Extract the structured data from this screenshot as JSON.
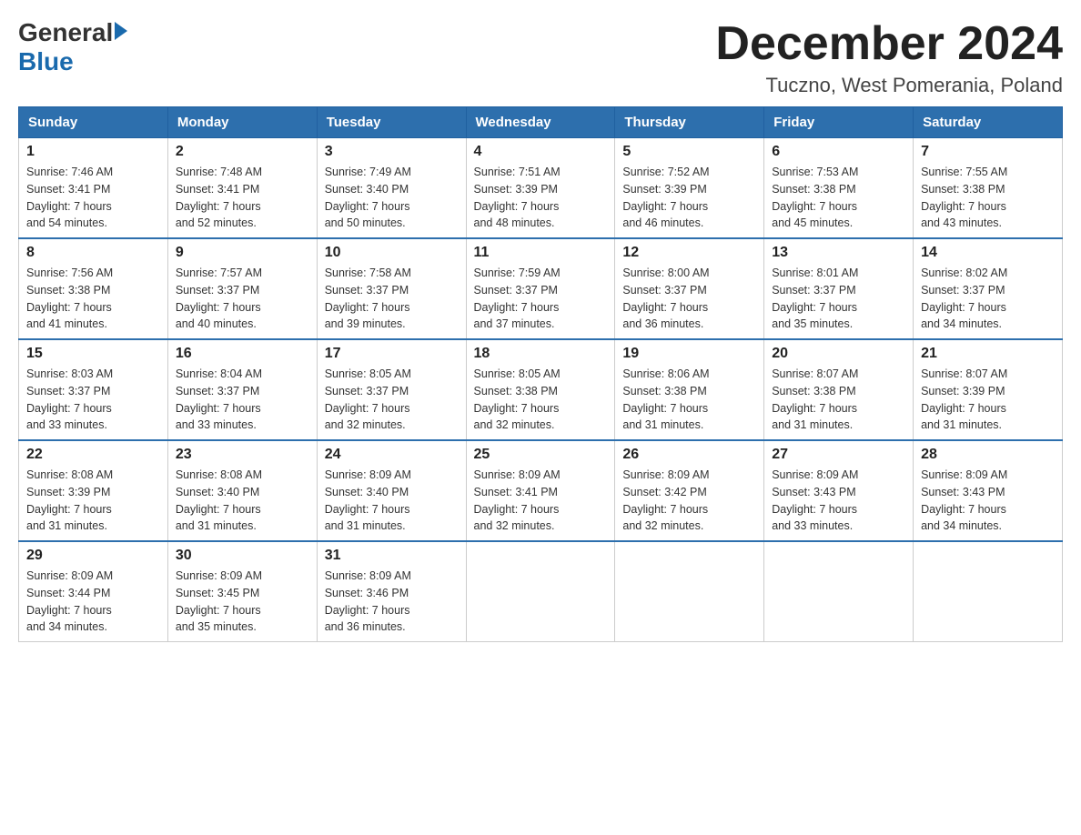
{
  "header": {
    "logo_general": "General",
    "logo_blue": "Blue",
    "month_title": "December 2024",
    "location": "Tuczno, West Pomerania, Poland"
  },
  "days_of_week": [
    "Sunday",
    "Monday",
    "Tuesday",
    "Wednesday",
    "Thursday",
    "Friday",
    "Saturday"
  ],
  "weeks": [
    [
      {
        "day": "1",
        "sunrise": "7:46 AM",
        "sunset": "3:41 PM",
        "daylight": "7 hours and 54 minutes."
      },
      {
        "day": "2",
        "sunrise": "7:48 AM",
        "sunset": "3:41 PM",
        "daylight": "7 hours and 52 minutes."
      },
      {
        "day": "3",
        "sunrise": "7:49 AM",
        "sunset": "3:40 PM",
        "daylight": "7 hours and 50 minutes."
      },
      {
        "day": "4",
        "sunrise": "7:51 AM",
        "sunset": "3:39 PM",
        "daylight": "7 hours and 48 minutes."
      },
      {
        "day": "5",
        "sunrise": "7:52 AM",
        "sunset": "3:39 PM",
        "daylight": "7 hours and 46 minutes."
      },
      {
        "day": "6",
        "sunrise": "7:53 AM",
        "sunset": "3:38 PM",
        "daylight": "7 hours and 45 minutes."
      },
      {
        "day": "7",
        "sunrise": "7:55 AM",
        "sunset": "3:38 PM",
        "daylight": "7 hours and 43 minutes."
      }
    ],
    [
      {
        "day": "8",
        "sunrise": "7:56 AM",
        "sunset": "3:38 PM",
        "daylight": "7 hours and 41 minutes."
      },
      {
        "day": "9",
        "sunrise": "7:57 AM",
        "sunset": "3:37 PM",
        "daylight": "7 hours and 40 minutes."
      },
      {
        "day": "10",
        "sunrise": "7:58 AM",
        "sunset": "3:37 PM",
        "daylight": "7 hours and 39 minutes."
      },
      {
        "day": "11",
        "sunrise": "7:59 AM",
        "sunset": "3:37 PM",
        "daylight": "7 hours and 37 minutes."
      },
      {
        "day": "12",
        "sunrise": "8:00 AM",
        "sunset": "3:37 PM",
        "daylight": "7 hours and 36 minutes."
      },
      {
        "day": "13",
        "sunrise": "8:01 AM",
        "sunset": "3:37 PM",
        "daylight": "7 hours and 35 minutes."
      },
      {
        "day": "14",
        "sunrise": "8:02 AM",
        "sunset": "3:37 PM",
        "daylight": "7 hours and 34 minutes."
      }
    ],
    [
      {
        "day": "15",
        "sunrise": "8:03 AM",
        "sunset": "3:37 PM",
        "daylight": "7 hours and 33 minutes."
      },
      {
        "day": "16",
        "sunrise": "8:04 AM",
        "sunset": "3:37 PM",
        "daylight": "7 hours and 33 minutes."
      },
      {
        "day": "17",
        "sunrise": "8:05 AM",
        "sunset": "3:37 PM",
        "daylight": "7 hours and 32 minutes."
      },
      {
        "day": "18",
        "sunrise": "8:05 AM",
        "sunset": "3:38 PM",
        "daylight": "7 hours and 32 minutes."
      },
      {
        "day": "19",
        "sunrise": "8:06 AM",
        "sunset": "3:38 PM",
        "daylight": "7 hours and 31 minutes."
      },
      {
        "day": "20",
        "sunrise": "8:07 AM",
        "sunset": "3:38 PM",
        "daylight": "7 hours and 31 minutes."
      },
      {
        "day": "21",
        "sunrise": "8:07 AM",
        "sunset": "3:39 PM",
        "daylight": "7 hours and 31 minutes."
      }
    ],
    [
      {
        "day": "22",
        "sunrise": "8:08 AM",
        "sunset": "3:39 PM",
        "daylight": "7 hours and 31 minutes."
      },
      {
        "day": "23",
        "sunrise": "8:08 AM",
        "sunset": "3:40 PM",
        "daylight": "7 hours and 31 minutes."
      },
      {
        "day": "24",
        "sunrise": "8:09 AM",
        "sunset": "3:40 PM",
        "daylight": "7 hours and 31 minutes."
      },
      {
        "day": "25",
        "sunrise": "8:09 AM",
        "sunset": "3:41 PM",
        "daylight": "7 hours and 32 minutes."
      },
      {
        "day": "26",
        "sunrise": "8:09 AM",
        "sunset": "3:42 PM",
        "daylight": "7 hours and 32 minutes."
      },
      {
        "day": "27",
        "sunrise": "8:09 AM",
        "sunset": "3:43 PM",
        "daylight": "7 hours and 33 minutes."
      },
      {
        "day": "28",
        "sunrise": "8:09 AM",
        "sunset": "3:43 PM",
        "daylight": "7 hours and 34 minutes."
      }
    ],
    [
      {
        "day": "29",
        "sunrise": "8:09 AM",
        "sunset": "3:44 PM",
        "daylight": "7 hours and 34 minutes."
      },
      {
        "day": "30",
        "sunrise": "8:09 AM",
        "sunset": "3:45 PM",
        "daylight": "7 hours and 35 minutes."
      },
      {
        "day": "31",
        "sunrise": "8:09 AM",
        "sunset": "3:46 PM",
        "daylight": "7 hours and 36 minutes."
      },
      null,
      null,
      null,
      null
    ]
  ],
  "labels": {
    "sunrise": "Sunrise:",
    "sunset": "Sunset:",
    "daylight": "Daylight:"
  }
}
